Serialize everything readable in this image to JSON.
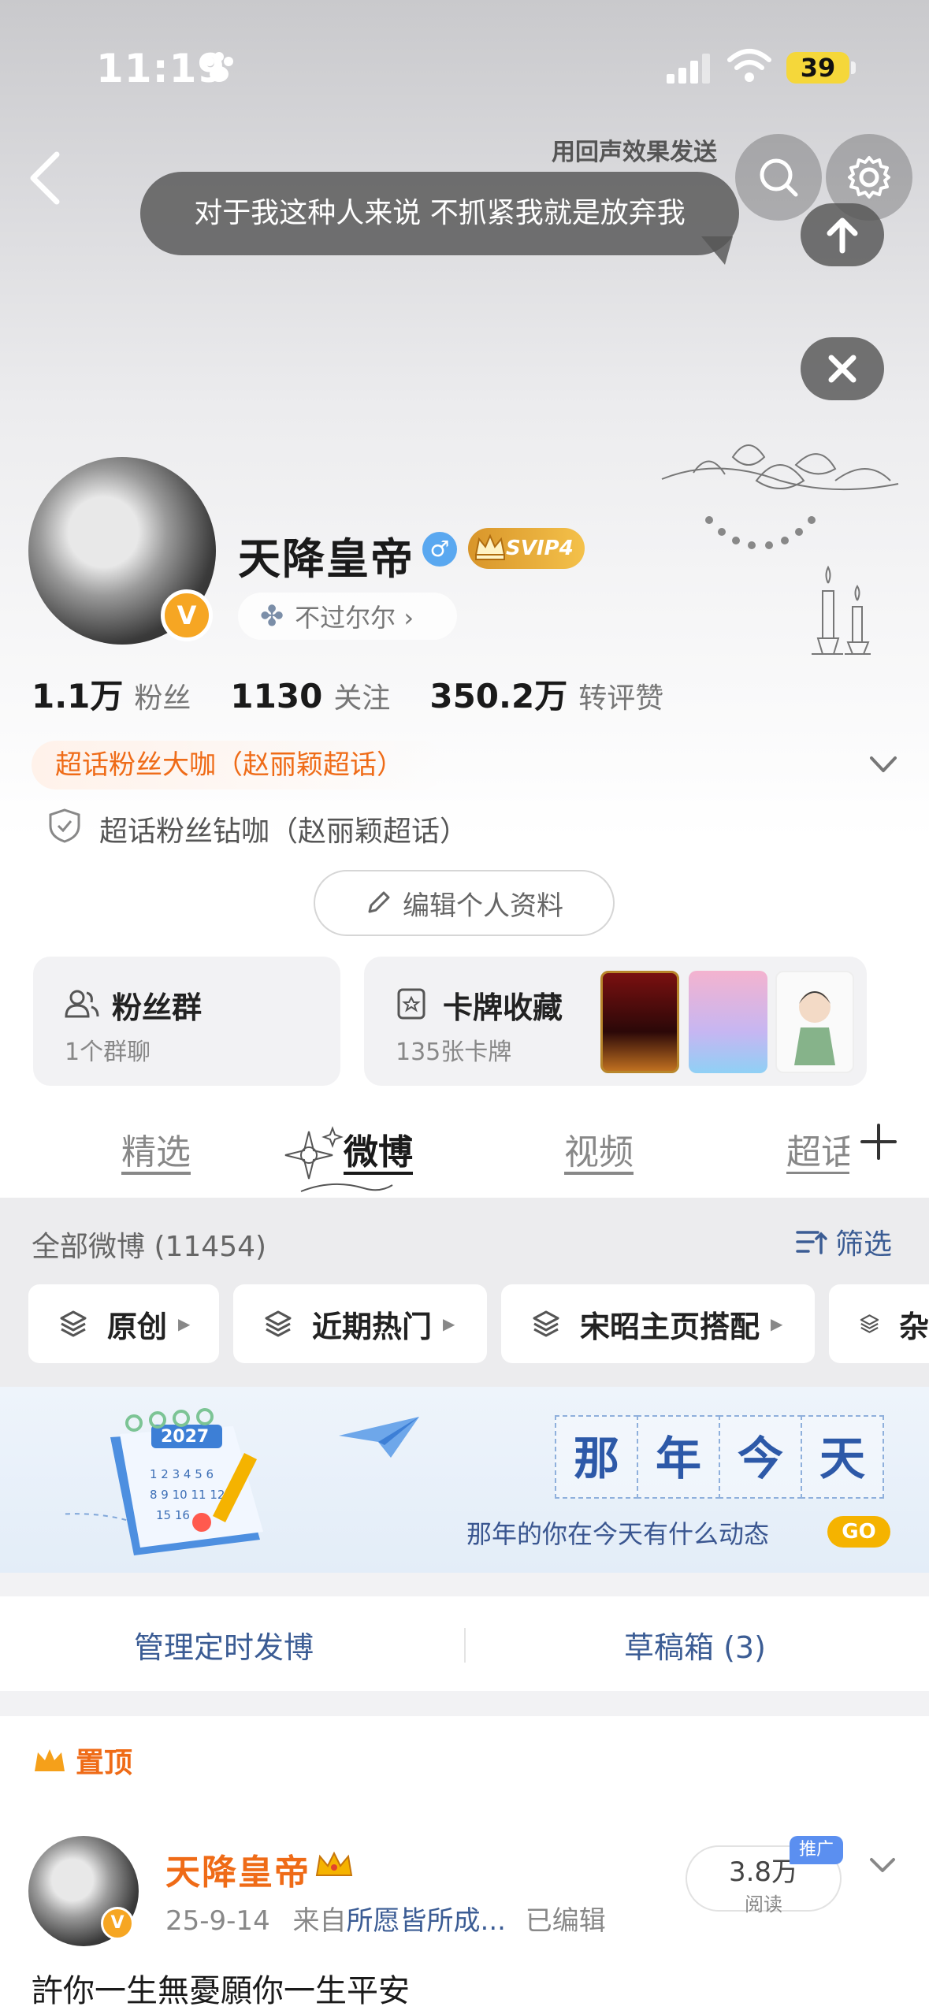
{
  "status_bar": {
    "time": "11:19",
    "battery": "39"
  },
  "header": {
    "echo_label": "用回声效果发送",
    "bubble_text": "对于我这种人来说 不抓紧我就是放弃我"
  },
  "profile": {
    "name": "天降皇帝",
    "svip": "SVIP4",
    "verified_badge": "V",
    "signature": "不过尔尔 ›",
    "stats": [
      {
        "value": "1.1万",
        "label": "粉丝"
      },
      {
        "value": "1130",
        "label": "关注"
      },
      {
        "value": "350.2万",
        "label": "转评赞"
      }
    ],
    "badge_primary": "超话粉丝大咖（赵丽颖超话）",
    "badge_secondary": "超话粉丝钻咖（赵丽颖超话）",
    "edit_label": "编辑个人资料"
  },
  "cards": {
    "fans": {
      "title": "粉丝群",
      "sub": "1个群聊"
    },
    "collection": {
      "title": "卡牌收藏",
      "sub": "135张卡牌"
    }
  },
  "tabs": [
    {
      "label": "精选"
    },
    {
      "label": "微博"
    },
    {
      "label": "视频"
    },
    {
      "label": "超话"
    }
  ],
  "feed": {
    "count_label": "全部微博 (11454)",
    "filter_label": "筛选",
    "chips": [
      {
        "label": "原创"
      },
      {
        "label": "近期热门"
      },
      {
        "label": "宋昭主页搭配"
      },
      {
        "label": "杂"
      }
    ]
  },
  "banner": {
    "grid": [
      "那",
      "年",
      "今",
      "天"
    ],
    "subtitle": "那年的你在今天有什么动态",
    "go": "GO",
    "calendar_year": "2027",
    "calendar_numbers": "1 2 3 4 5 6 / 8 9 10 11 12 / 15 16"
  },
  "actions": {
    "scheduled": "管理定时发博",
    "drafts": "草稿箱 (3)"
  },
  "post": {
    "pinned_label": "置顶",
    "author": "天降皇帝",
    "verified_badge": "V",
    "date": "25-9-14",
    "from_prefix": "来自",
    "source": "所愿皆所成...",
    "edited": "已编辑",
    "reads": "3.8万",
    "reads_label": "阅读",
    "promo": "推广",
    "text": "許你一生無憂願你一生平安"
  },
  "colors": {
    "accent_orange": "#ef6b17",
    "link_blue": "#3b5c94",
    "verified_gold": "#f6a623"
  }
}
